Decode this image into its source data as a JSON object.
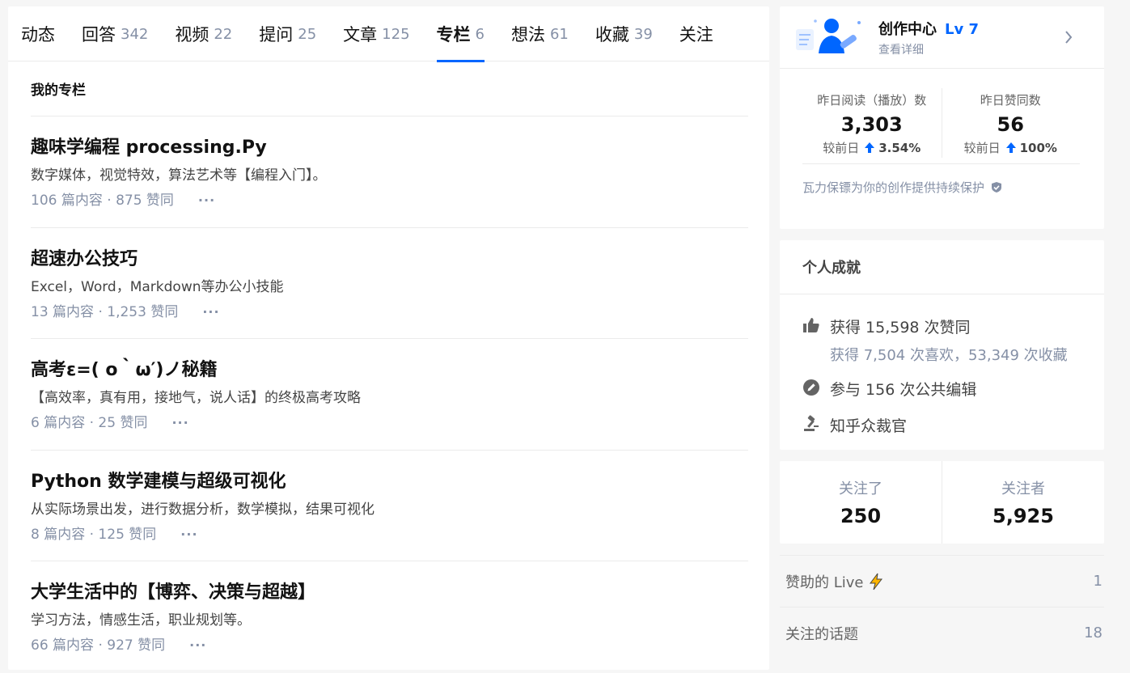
{
  "tabs": [
    {
      "label": "动态",
      "count": ""
    },
    {
      "label": "回答",
      "count": "342"
    },
    {
      "label": "视频",
      "count": "22"
    },
    {
      "label": "提问",
      "count": "25"
    },
    {
      "label": "文章",
      "count": "125"
    },
    {
      "label": "专栏",
      "count": "6",
      "active": true
    },
    {
      "label": "想法",
      "count": "61"
    },
    {
      "label": "收藏",
      "count": "39"
    },
    {
      "label": "关注",
      "count": ""
    }
  ],
  "section_title": "我的专栏",
  "columns": [
    {
      "title": "趣味学编程 processing.Py",
      "desc": "数字媒体，视觉特效，算法艺术等【编程入门】。",
      "meta": "106 篇内容 · 875 赞同"
    },
    {
      "title": "超速办公技巧",
      "desc": "Excel，Word，Markdown等办公小技能",
      "meta": "13 篇内容 · 1,253 赞同"
    },
    {
      "title": "高考ε=( o｀ω′)ノ秘籍",
      "desc": "【高效率，真有用，接地气，说人话】的终极高考攻略",
      "meta": "6 篇内容 · 25 赞同"
    },
    {
      "title": "Python 数学建模与超级可视化",
      "desc": "从实际场景出发，进行数据分析，数学模拟，结果可视化",
      "meta": "8 篇内容 · 125 赞同"
    },
    {
      "title": "大学生活中的【博弈、决策与超越】",
      "desc": "学习方法，情感生活，职业规划等。",
      "meta": "66 篇内容 · 927 赞同"
    }
  ],
  "more_label": "···",
  "creator": {
    "title": "创作中心",
    "level": "Lv 7",
    "subtitle": "查看详细",
    "stats": [
      {
        "label": "昨日阅读（播放）数",
        "value": "3,303",
        "compare": "较前日",
        "change": "3.54%"
      },
      {
        "label": "昨日赞同数",
        "value": "56",
        "compare": "较前日",
        "change": "100%"
      }
    ],
    "protect_text": "瓦力保镖为你的创作提供持续保护"
  },
  "achievements": {
    "title": "个人成就",
    "likes": "获得 15,598 次赞同",
    "likes_sub": "获得 7,504 次喜欢，53,349 次收藏",
    "edits": "参与 156 次公共编辑",
    "judge": "知乎众裁官"
  },
  "follow": {
    "following_label": "关注了",
    "following": "250",
    "followers_label": "关注者",
    "followers": "5,925"
  },
  "side_links": [
    {
      "label": "赞助的 Live",
      "count": "1",
      "icon": "lightning-icon"
    },
    {
      "label": "关注的话题",
      "count": "18"
    }
  ],
  "colors": {
    "accent": "#0066ff",
    "muted": "#8590a6",
    "bolt": "#ffb500"
  }
}
